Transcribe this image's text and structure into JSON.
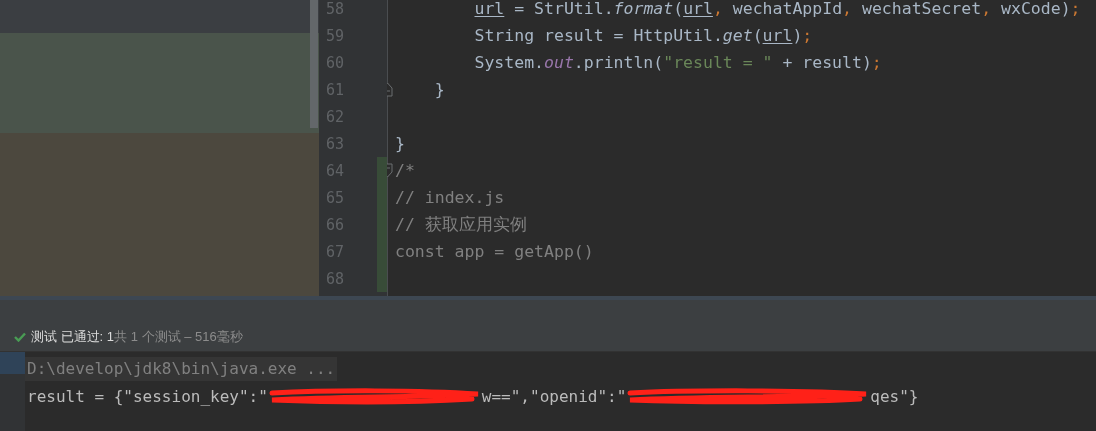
{
  "editor": {
    "lines": [
      {
        "number": "58",
        "kind": "plain",
        "changed": false,
        "tokens": [
          {
            "text": "        url",
            "kind": "underline"
          },
          {
            "text": " = StrUtil.",
            "kind": "plain"
          },
          {
            "text": "format",
            "kind": "italic"
          },
          {
            "text": "(",
            "kind": "plain"
          },
          {
            "text": "url",
            "kind": "underline"
          },
          {
            "text": ", ",
            "kind": "punct"
          },
          {
            "text": "wechatAppId",
            "kind": "plain"
          },
          {
            "text": ", ",
            "kind": "punct"
          },
          {
            "text": "wechatSecret",
            "kind": "plain"
          },
          {
            "text": ", ",
            "kind": "punct"
          },
          {
            "text": "wxCode)",
            "kind": "plain"
          },
          {
            "text": ";",
            "kind": "punct"
          }
        ]
      },
      {
        "number": "59",
        "kind": "plain",
        "changed": false,
        "tokens": [
          {
            "text": "        String result = HttpUtil.",
            "kind": "plain"
          },
          {
            "text": "get",
            "kind": "italic"
          },
          {
            "text": "(",
            "kind": "plain"
          },
          {
            "text": "url",
            "kind": "underline"
          },
          {
            "text": ")",
            "kind": "plain"
          },
          {
            "text": ";",
            "kind": "punct"
          }
        ]
      },
      {
        "number": "60",
        "kind": "plain",
        "changed": false,
        "tokens": [
          {
            "text": "        System.",
            "kind": "plain"
          },
          {
            "text": "out",
            "kind": "field"
          },
          {
            "text": ".println(",
            "kind": "plain"
          },
          {
            "text": "\"result = \"",
            "kind": "string"
          },
          {
            "text": " + result)",
            "kind": "plain"
          },
          {
            "text": ";",
            "kind": "punct"
          }
        ]
      },
      {
        "number": "61",
        "kind": "fold_end",
        "changed": false,
        "tokens": [
          {
            "text": "    }",
            "kind": "plain"
          }
        ]
      },
      {
        "number": "62",
        "kind": "plain",
        "changed": false
      },
      {
        "number": "63",
        "kind": "plain",
        "changed": false,
        "tokens": [
          {
            "text": "}",
            "kind": "plain"
          }
        ]
      },
      {
        "number": "64",
        "kind": "fold_start",
        "changed": true,
        "tokens": [
          {
            "text": "/*",
            "kind": "comment"
          }
        ]
      },
      {
        "number": "65",
        "kind": "plain",
        "changed": true,
        "tokens": [
          {
            "text": "// index.js",
            "kind": "comment"
          }
        ]
      },
      {
        "number": "66",
        "kind": "plain",
        "changed": true,
        "tokens": [
          {
            "text": "// 获取应用实例",
            "kind": "comment"
          }
        ]
      },
      {
        "number": "67",
        "kind": "plain",
        "changed": true,
        "tokens": [
          {
            "text": "const app = getApp()",
            "kind": "comment"
          }
        ]
      },
      {
        "number": "68",
        "kind": "plain",
        "changed": true
      }
    ]
  },
  "test_status": {
    "passed": true,
    "text": "**测试 已通过: 1**共 1 个测试 – 516毫秒"
  },
  "console": {
    "lines": [
      {
        "kind": "command",
        "segments": [
          {
            "kind": "text",
            "text": "D:\\develop\\jdk8\\bin\\java.exe ..."
          }
        ]
      },
      {
        "kind": "output",
        "segments": [
          {
            "kind": "text",
            "text": "result = {\"session_key\":\""
          },
          {
            "kind": "redaction"
          },
          {
            "kind": "text",
            "text": "w==\",\"openid\":\""
          },
          {
            "kind": "redaction"
          },
          {
            "kind": "text",
            "text": "qes\"}"
          }
        ]
      }
    ]
  }
}
